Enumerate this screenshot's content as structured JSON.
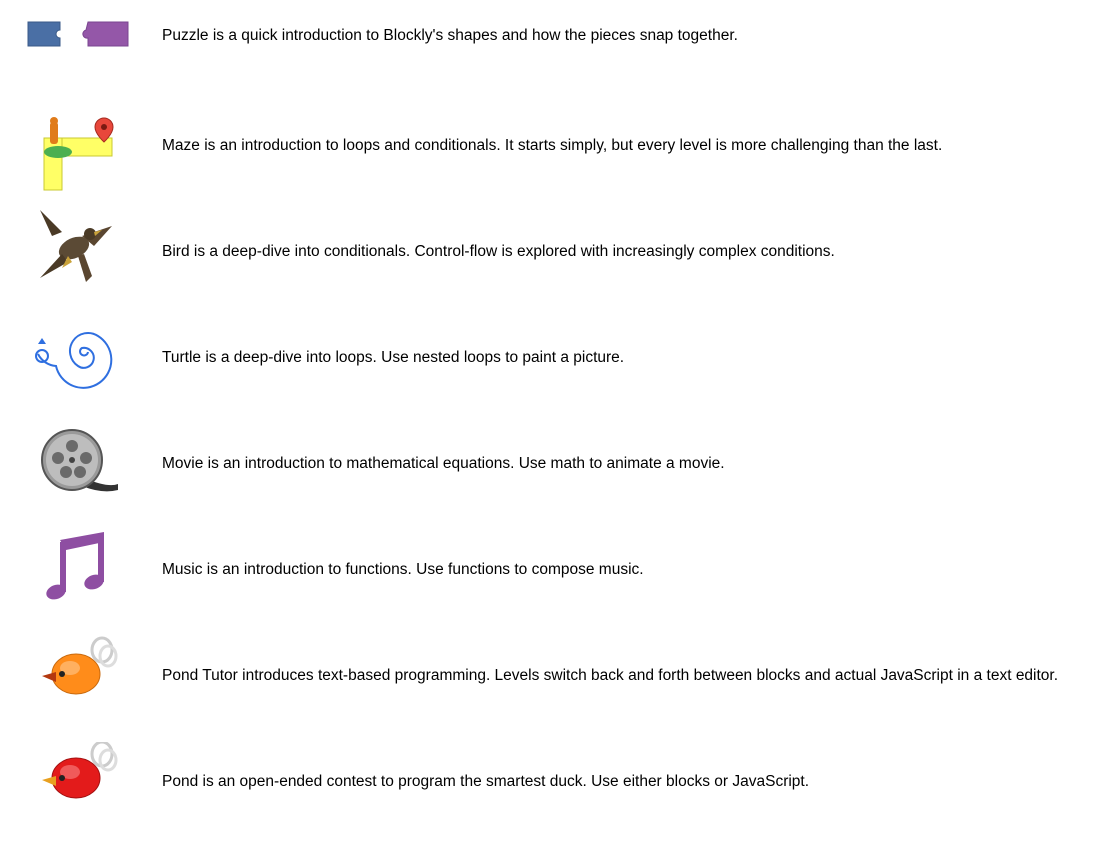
{
  "apps": [
    {
      "name": "Puzzle",
      "icon": "puzzle-pieces-icon",
      "description": "Puzzle is a quick introduction to Blockly's shapes and how the pieces snap together."
    },
    {
      "name": "Maze",
      "icon": "maze-pegman-icon",
      "description": "Maze is an introduction to loops and conditionals. It starts simply, but every level is more challenging than the last."
    },
    {
      "name": "Bird",
      "icon": "bird-icon",
      "description": "Bird is a deep-dive into conditionals. Control-flow is explored with increasingly complex conditions."
    },
    {
      "name": "Turtle",
      "icon": "turtle-spiral-icon",
      "description": "Turtle is a deep-dive into loops. Use nested loops to paint a picture."
    },
    {
      "name": "Movie",
      "icon": "film-reel-icon",
      "description": "Movie is an introduction to mathematical equations. Use math to animate a movie."
    },
    {
      "name": "Music",
      "icon": "music-note-icon",
      "description": "Music is an introduction to functions. Use functions to compose music."
    },
    {
      "name": "Pond Tutor",
      "icon": "pond-duck-orange-icon",
      "description": "Pond Tutor introduces text-based programming. Levels switch back and forth between blocks and actual JavaScript in a text editor."
    },
    {
      "name": "Pond",
      "icon": "pond-duck-red-icon",
      "description": "Pond is an open-ended contest to program the smartest duck. Use either blocks or JavaScript."
    }
  ],
  "colors": {
    "puzzle_blue": "#4a6fa5",
    "puzzle_purple": "#9457a8",
    "maze_yellow": "#ffff66",
    "maze_pin_red": "#e8473b",
    "turtle_blue": "#2f6fe0",
    "music_purple": "#8e4ea2",
    "duck_orange": "#ff8c1a",
    "duck_red": "#e31b1b"
  }
}
